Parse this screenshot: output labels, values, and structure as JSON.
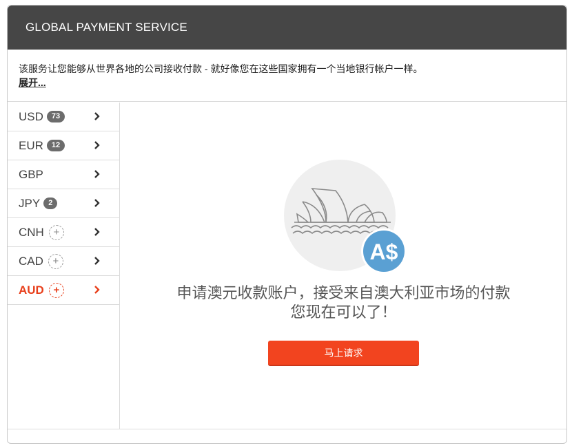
{
  "header": {
    "title": "GLOBAL PAYMENT SERVICE"
  },
  "intro": {
    "text": "该服务让您能够从世界各地的公司接收付款 - 就好像您在这些国家拥有一个当地银行帐户一样。",
    "more_link": "展开..."
  },
  "sidebar": {
    "items": [
      {
        "code": "USD",
        "badge": "73",
        "state": "badge"
      },
      {
        "code": "EUR",
        "badge": "12",
        "state": "badge"
      },
      {
        "code": "GBP",
        "badge": "",
        "state": "none"
      },
      {
        "code": "JPY",
        "badge": "2",
        "state": "badge"
      },
      {
        "code": "CNH",
        "badge": "+",
        "state": "add"
      },
      {
        "code": "CAD",
        "badge": "+",
        "state": "add"
      },
      {
        "code": "AUD",
        "badge": "+",
        "state": "add-active"
      }
    ]
  },
  "promo": {
    "badge_text": "A$",
    "line1": "申请澳元收款账户，接受来自澳大利亚市场的付款",
    "line2": "您现在可以了！",
    "button_label": "马上请求"
  },
  "colors": {
    "header_bg": "#464646",
    "accent": "#e8401c",
    "button": "#f2441f",
    "coin": "#5aa0d3"
  }
}
